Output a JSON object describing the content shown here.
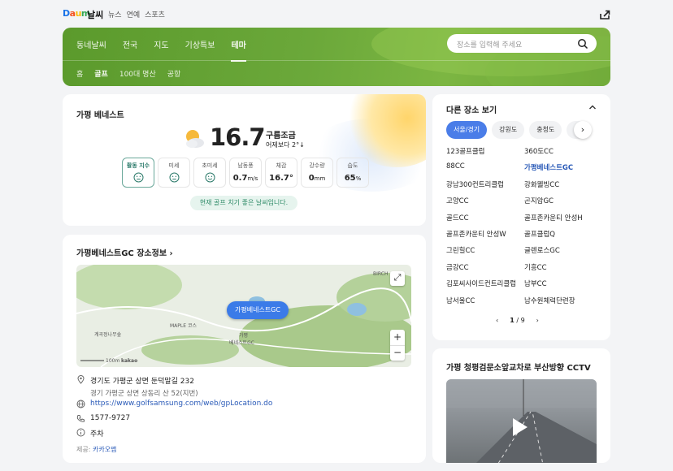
{
  "brand": {
    "logo": "Daum",
    "section": "날씨"
  },
  "topnav": [
    "뉴스",
    "연예",
    "스포츠"
  ],
  "header": {
    "tabs": [
      "동네날씨",
      "전국",
      "지도",
      "기상특보",
      "테마"
    ],
    "active_tab": "테마",
    "subtabs": [
      "홈",
      "골프",
      "100대 명산",
      "공항"
    ],
    "active_subtab": "골프",
    "search_placeholder": "장소를 입력해 주세요"
  },
  "weather": {
    "place": "가평 베네스트",
    "temperature": "16.7",
    "unit": "°",
    "condition": "구름조금",
    "compare": "어제보다 2°↓",
    "metrics": [
      {
        "label": "활동 지수",
        "value": "",
        "face": "normal"
      },
      {
        "label": "미세",
        "value": "",
        "face": "normal"
      },
      {
        "label": "초미세",
        "value": "",
        "face": "good"
      },
      {
        "label": "남동풍",
        "value": "0.7",
        "unit": "m/s"
      },
      {
        "label": "체감",
        "value": "16.7°",
        "unit": ""
      },
      {
        "label": "강수량",
        "value": "0",
        "unit": "mm"
      },
      {
        "label": "습도",
        "value": "65",
        "unit": "%"
      }
    ],
    "tip": "현재 골프 치기 좋은 날씨입니다."
  },
  "place_info": {
    "title": "가평베네스트GC 장소정보",
    "map": {
      "pin": "가평베네스트GC",
      "labels": [
        "BIRCH",
        "MAPLE 코스",
        "가평",
        "베네스트GC",
        "계곡정나무숲"
      ],
      "scale": "100m",
      "brand": "kakao"
    },
    "address": "경기도 가평군 상면 둔덕말길 232",
    "address_jibun": "경기 가평군 상면 상동리 산 52(지번)",
    "url": "https://www.golfsamsung.com/web/gpLocation.do",
    "phone": "1577-9727",
    "parking": "주차",
    "source_label": "제공:",
    "source": "카카오맵"
  },
  "others": {
    "title": "다른 장소 보기",
    "regions": [
      "서울/경기",
      "강원도",
      "충청도",
      "전"
    ],
    "active_region": "서울/경기",
    "places": [
      "123골프클럽",
      "360도CC",
      "88CC",
      "가평베네스트GC",
      "강남300컨트리클럽",
      "강화웰빙CC",
      "고양CC",
      "곤지암GC",
      "골드CC",
      "골프존카운티 안성H",
      "골프존카운티 안성W",
      "골프클럽Q",
      "그린힐CC",
      "글렌로스GC",
      "금강CC",
      "기흥CC",
      "김포씨사이드컨트리클럽",
      "남부CC",
      "남서울CC",
      "남수원체력단련장"
    ],
    "highlighted": "가평베네스트GC",
    "page": "1",
    "total_pages": "9"
  },
  "cctv": {
    "title": "가평 청평검문소앞교차로 부산방향 CCTV"
  },
  "colors": {
    "green": "#6ba83a",
    "accent_blue": "#4a7de8",
    "link": "#2b5bb8"
  }
}
